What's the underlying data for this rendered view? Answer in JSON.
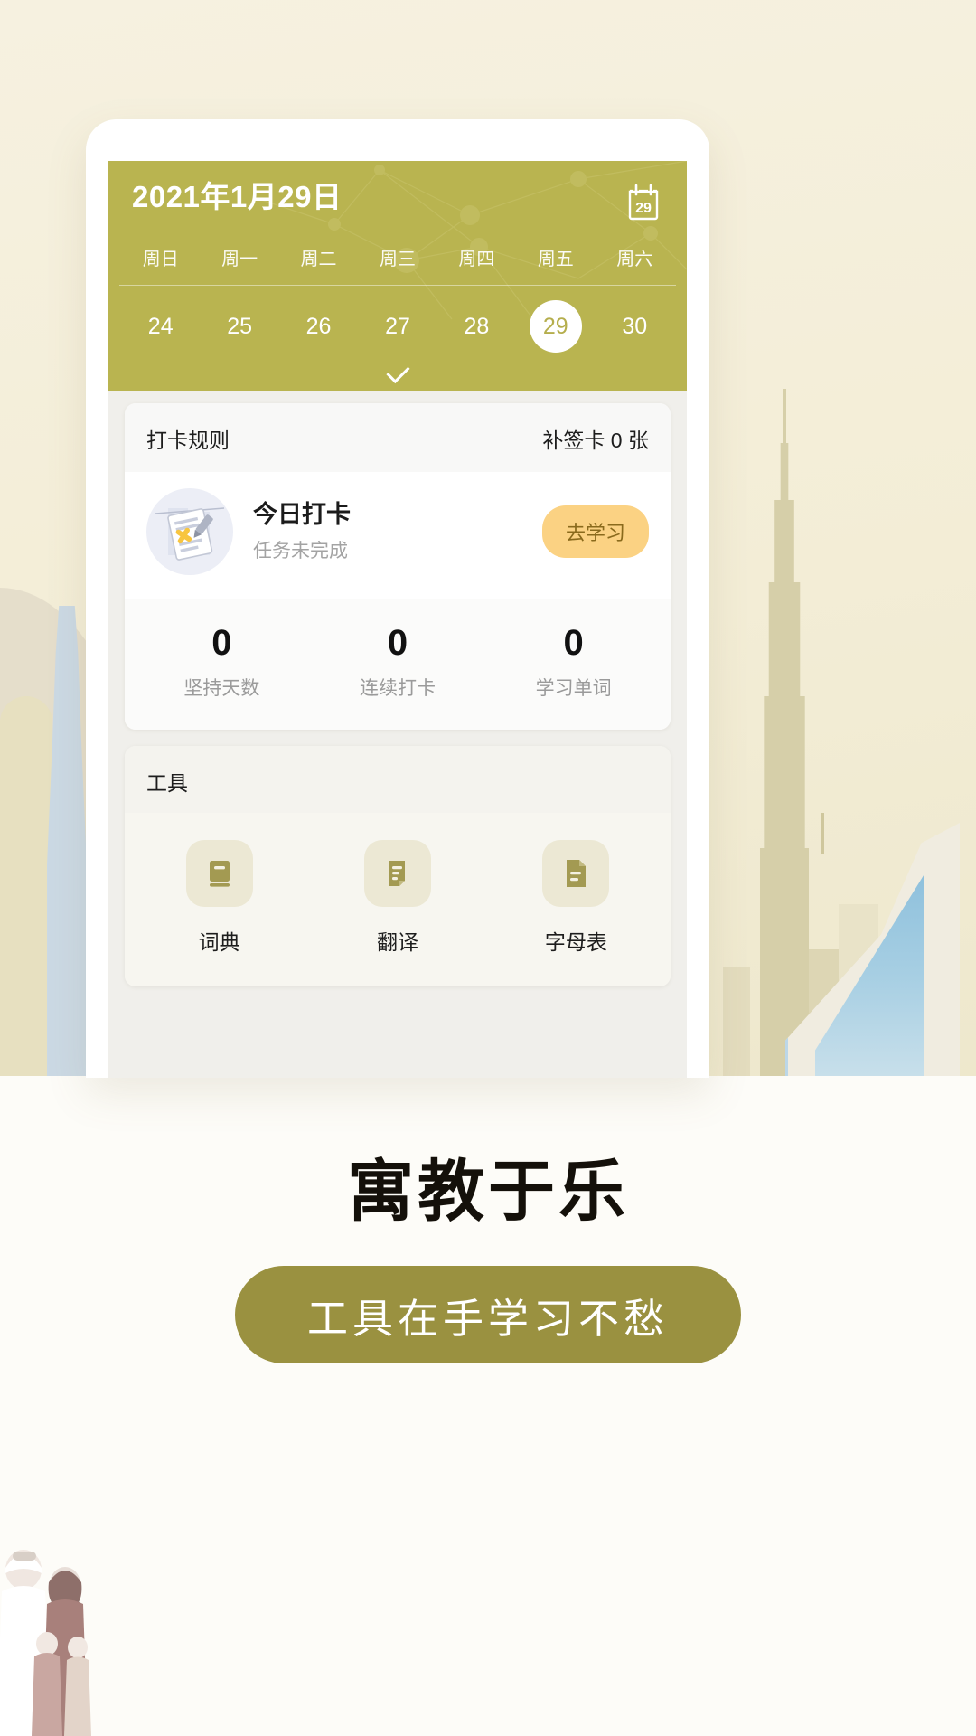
{
  "phone": {
    "header": {
      "date_title": "2021年1月29日",
      "calendar_icon_day": "29",
      "weekdays": [
        "周日",
        "周一",
        "周二",
        "周三",
        "周四",
        "周五",
        "周六"
      ],
      "dates": [
        "24",
        "25",
        "26",
        "27",
        "28",
        "29",
        "30"
      ],
      "selected_date": "29",
      "expand_icon": "chevron-down-icon",
      "bg_color": "#b9b450"
    },
    "checkin_card": {
      "rules_label": "打卡规则",
      "makeup_card_label": "补签卡 0 张",
      "today_title": "今日打卡",
      "today_status": "任务未完成",
      "action_button": "去学习",
      "action_button_color": "#fbd283",
      "stats": [
        {
          "value": "0",
          "label": "坚持天数"
        },
        {
          "value": "0",
          "label": "连续打卡"
        },
        {
          "value": "0",
          "label": "学习单词"
        }
      ]
    },
    "tools_card": {
      "title": "工具",
      "items": [
        {
          "label": "词典",
          "icon": "book-icon"
        },
        {
          "label": "翻译",
          "icon": "document-lines-icon"
        },
        {
          "label": "字母表",
          "icon": "document-text-icon"
        }
      ]
    }
  },
  "marketing": {
    "headline": "寓教于乐",
    "cta_label": "工具在手学习不愁",
    "cta_color": "#9a9140"
  }
}
